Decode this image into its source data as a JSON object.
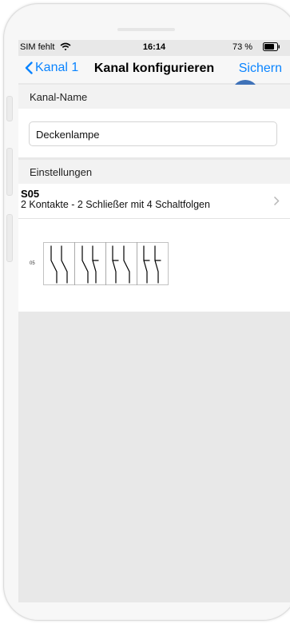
{
  "status_bar": {
    "carrier": "SIM fehlt",
    "time": "16:14",
    "battery": "73 %",
    "icons": [
      "wifi-icon",
      "battery-icon"
    ]
  },
  "nav": {
    "back_label": "Kanal 1",
    "title": "Kanal konfigurieren",
    "save_label": "Sichern",
    "accent_color": "#0a84ff"
  },
  "channel_name": {
    "header": "Kanal-Name",
    "value": "Deckenlampe"
  },
  "settings": {
    "header": "Einstellungen",
    "row": {
      "title": "S05",
      "subtitle": "2 Kontakte - 2 Schließer mit 4 Schaltfolgen"
    }
  },
  "diagram": {
    "label": "05",
    "steps": 4,
    "icon": "switch-sequence-diagram"
  },
  "touch_indicator_color": "#3f72b8"
}
